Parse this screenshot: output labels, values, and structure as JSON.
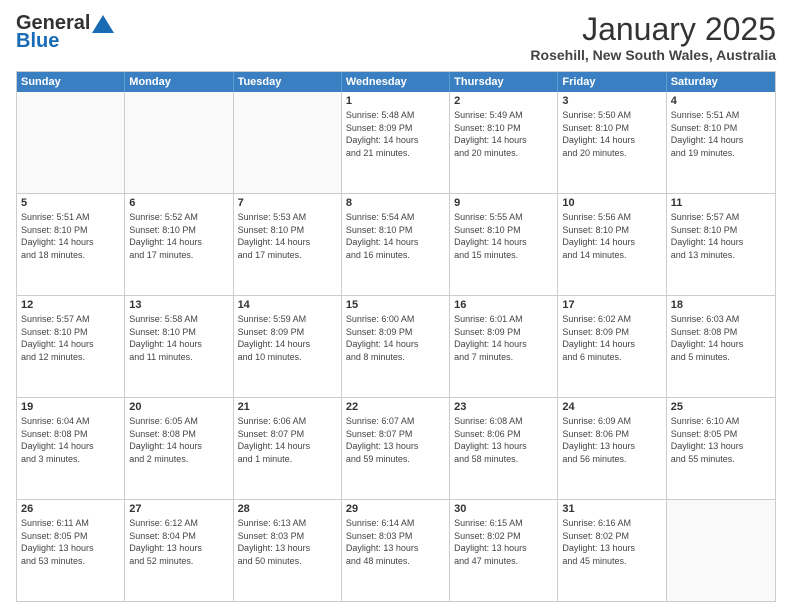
{
  "logo": {
    "line1": "General",
    "line2": "Blue"
  },
  "title": "January 2025",
  "subtitle": "Rosehill, New South Wales, Australia",
  "headers": [
    "Sunday",
    "Monday",
    "Tuesday",
    "Wednesday",
    "Thursday",
    "Friday",
    "Saturday"
  ],
  "weeks": [
    [
      {
        "day": "",
        "info": ""
      },
      {
        "day": "",
        "info": ""
      },
      {
        "day": "",
        "info": ""
      },
      {
        "day": "1",
        "info": "Sunrise: 5:48 AM\nSunset: 8:09 PM\nDaylight: 14 hours\nand 21 minutes."
      },
      {
        "day": "2",
        "info": "Sunrise: 5:49 AM\nSunset: 8:10 PM\nDaylight: 14 hours\nand 20 minutes."
      },
      {
        "day": "3",
        "info": "Sunrise: 5:50 AM\nSunset: 8:10 PM\nDaylight: 14 hours\nand 20 minutes."
      },
      {
        "day": "4",
        "info": "Sunrise: 5:51 AM\nSunset: 8:10 PM\nDaylight: 14 hours\nand 19 minutes."
      }
    ],
    [
      {
        "day": "5",
        "info": "Sunrise: 5:51 AM\nSunset: 8:10 PM\nDaylight: 14 hours\nand 18 minutes."
      },
      {
        "day": "6",
        "info": "Sunrise: 5:52 AM\nSunset: 8:10 PM\nDaylight: 14 hours\nand 17 minutes."
      },
      {
        "day": "7",
        "info": "Sunrise: 5:53 AM\nSunset: 8:10 PM\nDaylight: 14 hours\nand 17 minutes."
      },
      {
        "day": "8",
        "info": "Sunrise: 5:54 AM\nSunset: 8:10 PM\nDaylight: 14 hours\nand 16 minutes."
      },
      {
        "day": "9",
        "info": "Sunrise: 5:55 AM\nSunset: 8:10 PM\nDaylight: 14 hours\nand 15 minutes."
      },
      {
        "day": "10",
        "info": "Sunrise: 5:56 AM\nSunset: 8:10 PM\nDaylight: 14 hours\nand 14 minutes."
      },
      {
        "day": "11",
        "info": "Sunrise: 5:57 AM\nSunset: 8:10 PM\nDaylight: 14 hours\nand 13 minutes."
      }
    ],
    [
      {
        "day": "12",
        "info": "Sunrise: 5:57 AM\nSunset: 8:10 PM\nDaylight: 14 hours\nand 12 minutes."
      },
      {
        "day": "13",
        "info": "Sunrise: 5:58 AM\nSunset: 8:10 PM\nDaylight: 14 hours\nand 11 minutes."
      },
      {
        "day": "14",
        "info": "Sunrise: 5:59 AM\nSunset: 8:09 PM\nDaylight: 14 hours\nand 10 minutes."
      },
      {
        "day": "15",
        "info": "Sunrise: 6:00 AM\nSunset: 8:09 PM\nDaylight: 14 hours\nand 8 minutes."
      },
      {
        "day": "16",
        "info": "Sunrise: 6:01 AM\nSunset: 8:09 PM\nDaylight: 14 hours\nand 7 minutes."
      },
      {
        "day": "17",
        "info": "Sunrise: 6:02 AM\nSunset: 8:09 PM\nDaylight: 14 hours\nand 6 minutes."
      },
      {
        "day": "18",
        "info": "Sunrise: 6:03 AM\nSunset: 8:08 PM\nDaylight: 14 hours\nand 5 minutes."
      }
    ],
    [
      {
        "day": "19",
        "info": "Sunrise: 6:04 AM\nSunset: 8:08 PM\nDaylight: 14 hours\nand 3 minutes."
      },
      {
        "day": "20",
        "info": "Sunrise: 6:05 AM\nSunset: 8:08 PM\nDaylight: 14 hours\nand 2 minutes."
      },
      {
        "day": "21",
        "info": "Sunrise: 6:06 AM\nSunset: 8:07 PM\nDaylight: 14 hours\nand 1 minute."
      },
      {
        "day": "22",
        "info": "Sunrise: 6:07 AM\nSunset: 8:07 PM\nDaylight: 13 hours\nand 59 minutes."
      },
      {
        "day": "23",
        "info": "Sunrise: 6:08 AM\nSunset: 8:06 PM\nDaylight: 13 hours\nand 58 minutes."
      },
      {
        "day": "24",
        "info": "Sunrise: 6:09 AM\nSunset: 8:06 PM\nDaylight: 13 hours\nand 56 minutes."
      },
      {
        "day": "25",
        "info": "Sunrise: 6:10 AM\nSunset: 8:05 PM\nDaylight: 13 hours\nand 55 minutes."
      }
    ],
    [
      {
        "day": "26",
        "info": "Sunrise: 6:11 AM\nSunset: 8:05 PM\nDaylight: 13 hours\nand 53 minutes."
      },
      {
        "day": "27",
        "info": "Sunrise: 6:12 AM\nSunset: 8:04 PM\nDaylight: 13 hours\nand 52 minutes."
      },
      {
        "day": "28",
        "info": "Sunrise: 6:13 AM\nSunset: 8:03 PM\nDaylight: 13 hours\nand 50 minutes."
      },
      {
        "day": "29",
        "info": "Sunrise: 6:14 AM\nSunset: 8:03 PM\nDaylight: 13 hours\nand 48 minutes."
      },
      {
        "day": "30",
        "info": "Sunrise: 6:15 AM\nSunset: 8:02 PM\nDaylight: 13 hours\nand 47 minutes."
      },
      {
        "day": "31",
        "info": "Sunrise: 6:16 AM\nSunset: 8:02 PM\nDaylight: 13 hours\nand 45 minutes."
      },
      {
        "day": "",
        "info": ""
      }
    ]
  ]
}
